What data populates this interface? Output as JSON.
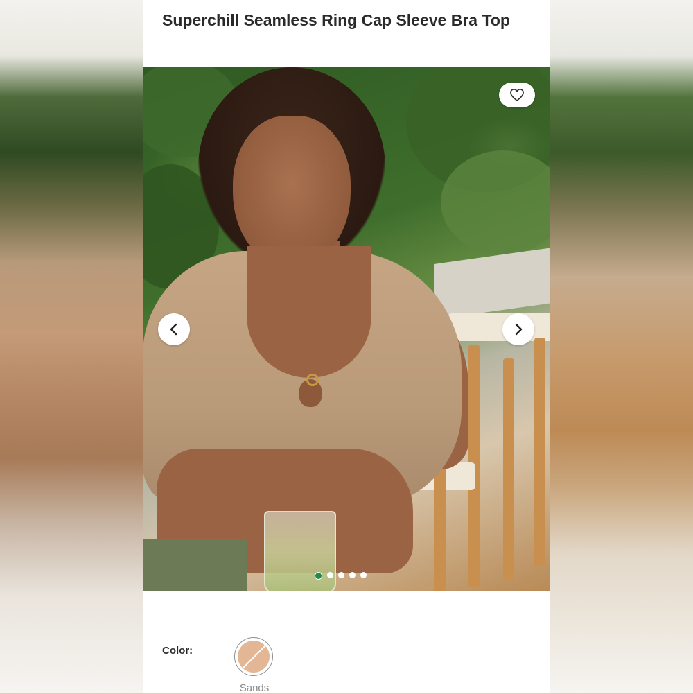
{
  "product": {
    "title": "Superchill Seamless Ring Cap Sleeve Bra Top"
  },
  "gallery": {
    "image_alt": "Model wearing a tan ribbed cap sleeve bra top holding a glass",
    "slide_count": 5,
    "active_slide": 1,
    "favorite_icon": "heart-icon",
    "prev_icon": "chevron-left-icon",
    "next_icon": "chevron-right-icon"
  },
  "color_picker": {
    "label": "Color:",
    "selected": {
      "name": "Sands",
      "hex": "#e3b795",
      "unavailable": true
    }
  },
  "colors": {
    "active_dot": "#1f8a52",
    "text": "#2a2a2a",
    "muted": "#8a8a8a"
  }
}
